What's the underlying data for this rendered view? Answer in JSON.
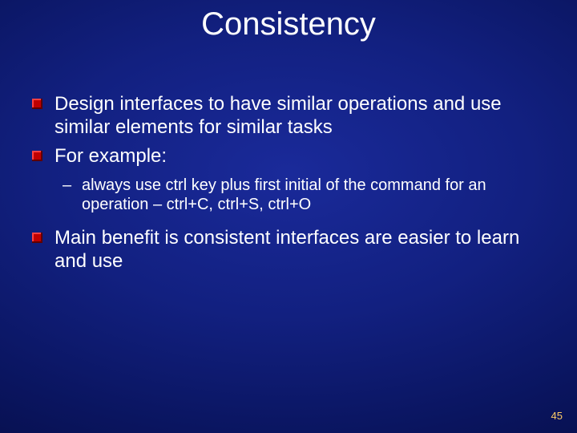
{
  "title": "Consistency",
  "bullets": {
    "b1": "Design interfaces to have similar operations and use similar elements for similar tasks",
    "b2": "For example:",
    "b2_sub1": "always use ctrl key plus first initial of the command for an operation – ctrl+C, ctrl+S, ctrl+O",
    "b3": "Main benefit is consistent interfaces are easier to learn and use"
  },
  "page_number": "45"
}
